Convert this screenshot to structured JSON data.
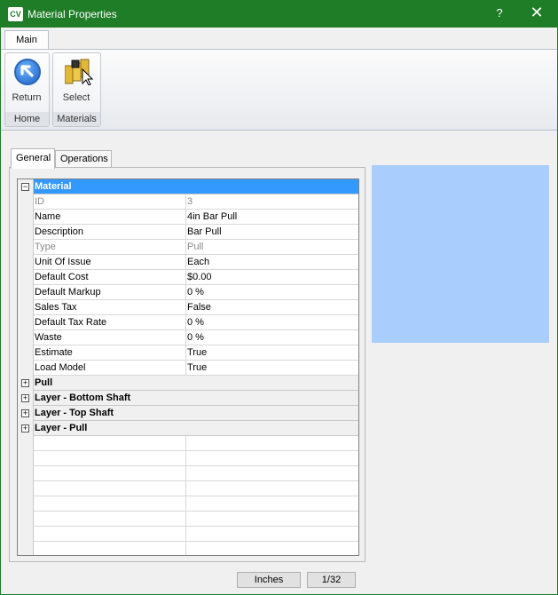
{
  "window": {
    "icon_text": "CV",
    "title": "Material Properties",
    "help_glyph": "?",
    "close_glyph": "✕"
  },
  "ribbon": {
    "tab": "Main",
    "groups": [
      {
        "label": "Home",
        "button": "Return"
      },
      {
        "label": "Materials",
        "button": "Select"
      }
    ]
  },
  "tabs": [
    "General",
    "Operations"
  ],
  "grid": {
    "categories": [
      {
        "label": "Material",
        "expanded": true,
        "selected": true,
        "expander": "−",
        "properties": [
          {
            "name": "ID",
            "value": "3",
            "readonly": true
          },
          {
            "name": "Name",
            "value": "4in Bar Pull",
            "readonly": false
          },
          {
            "name": "Description",
            "value": "Bar Pull",
            "readonly": false
          },
          {
            "name": "Type",
            "value": "Pull",
            "readonly": true
          },
          {
            "name": "Unit Of Issue",
            "value": "Each",
            "readonly": false
          },
          {
            "name": "Default Cost",
            "value": "$0.00",
            "readonly": false
          },
          {
            "name": "Default Markup",
            "value": "0 %",
            "readonly": false
          },
          {
            "name": "Sales Tax",
            "value": "False",
            "readonly": false
          },
          {
            "name": "Default Tax Rate",
            "value": "0 %",
            "readonly": false
          },
          {
            "name": "Waste",
            "value": "0 %",
            "readonly": false
          },
          {
            "name": "Estimate",
            "value": "True",
            "readonly": false
          },
          {
            "name": "Load Model",
            "value": "True",
            "readonly": false
          }
        ]
      },
      {
        "label": "Pull",
        "expanded": false,
        "expander": "+"
      },
      {
        "label": "Layer - Bottom Shaft",
        "expanded": false,
        "expander": "+"
      },
      {
        "label": "Layer - Top Shaft",
        "expanded": false,
        "expander": "+"
      },
      {
        "label": "Layer - Pull",
        "expanded": false,
        "expander": "+"
      }
    ]
  },
  "status": {
    "units": "Inches",
    "precision": "1/32"
  },
  "colors": {
    "titlebar": "#1e7d26",
    "selection": "#3399ff",
    "preview": "#a9cdfc"
  },
  "icons": {
    "return": "return-arrow-icon",
    "select": "select-materials-icon"
  }
}
